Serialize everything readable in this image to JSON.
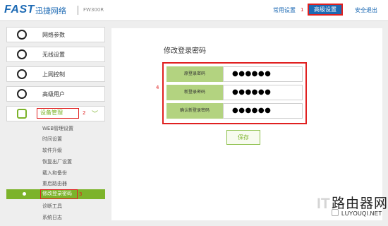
{
  "header": {
    "logo": "FAST",
    "brand": "迅捷网络",
    "model": "FW300R",
    "nav_common": "常用设置",
    "nav_marker": "1",
    "nav_advanced": "高级设置",
    "nav_logout": "安全退出"
  },
  "sidebar": {
    "items": [
      {
        "label": "网络参数",
        "icon": "globe-icon"
      },
      {
        "label": "无线设置",
        "icon": "wifi-icon"
      },
      {
        "label": "上网控制",
        "icon": "control-icon"
      },
      {
        "label": "高级用户",
        "icon": "user-icon"
      }
    ],
    "active": {
      "label": "设备管理",
      "marker": "2",
      "icon": "device-icon"
    },
    "sub_items": [
      "WEB管理设置",
      "时间设置",
      "软件升级",
      "恢复出厂设置",
      "载入和备份",
      "重启路由器"
    ],
    "sub_active": {
      "label": "修改登录密码",
      "marker": "3"
    },
    "sub_after": [
      "诊断工具",
      "系统日志"
    ]
  },
  "panel": {
    "title": "修改登录密码",
    "marker": "4",
    "rows": [
      {
        "label": "原登录密码",
        "value": "●●●●●●"
      },
      {
        "label": "新登录密码",
        "value": "●●●●●●"
      },
      {
        "label": "确认新登录密码",
        "value": "●●●●●●"
      }
    ],
    "save_label": "保存"
  },
  "watermark": {
    "it": "IT",
    "main": "路由器网",
    "url": "LUYOUQI.NET"
  },
  "colors": {
    "accent_blue": "#1d6ab4",
    "accent_green": "#7cb32a",
    "annotation_red": "#e02020"
  }
}
